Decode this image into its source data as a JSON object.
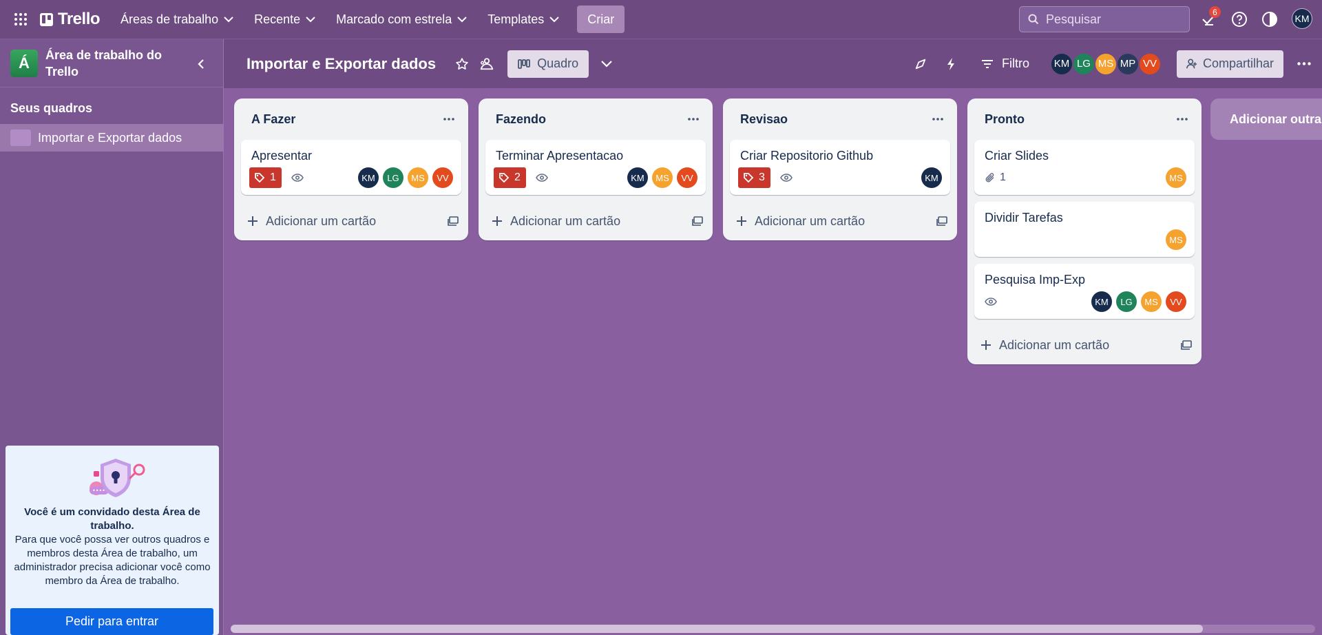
{
  "nav": {
    "logo": "Trello",
    "workspaces": "Áreas de trabalho",
    "recent": "Recente",
    "starred": "Marcado com estrela",
    "templates": "Templates",
    "create": "Criar",
    "search_placeholder": "Pesquisar",
    "notifications_count": "6",
    "user_initials": "KM"
  },
  "sidebar": {
    "workspace_initial": "Á",
    "workspace_name": "Área de trabalho do Trello",
    "boards_title": "Seus quadros",
    "boards": [
      {
        "label": "Importar e Exportar dados"
      }
    ],
    "guest": {
      "title": "Você é um convidado desta Área de trabalho.",
      "body": "Para que você possa ver outros quadros e membros desta Área de trabalho, um administrador precisa adicionar você como membro da Área de trabalho.",
      "button": "Pedir para entrar"
    }
  },
  "board": {
    "title": "Importar e Exportar dados",
    "view": "Quadro",
    "filter": "Filtro",
    "share": "Compartilhar",
    "members": [
      {
        "initials": "KM",
        "color": "#172b4d"
      },
      {
        "initials": "LG",
        "color": "#1f845a"
      },
      {
        "initials": "MS",
        "color": "#f5a22f"
      },
      {
        "initials": "MP",
        "color": "#2b3a5c"
      },
      {
        "initials": "VV",
        "color": "#e34b1f"
      }
    ],
    "add_list": "Adicionar outra lista"
  },
  "lists": [
    {
      "title": "A Fazer",
      "add_card": "Adicionar um cartão",
      "cards": [
        {
          "title": "Apresentar",
          "badge": "1",
          "members": [
            "KM",
            "LG",
            "MS",
            "VV"
          ]
        }
      ]
    },
    {
      "title": "Fazendo",
      "add_card": "Adicionar um cartão",
      "cards": [
        {
          "title": "Terminar Apresentacao",
          "badge": "2",
          "members": [
            "KM",
            "MS",
            "VV"
          ]
        }
      ]
    },
    {
      "title": "Revisao",
      "add_card": "Adicionar um cartão",
      "cards": [
        {
          "title": "Criar Repositorio Github",
          "badge": "3",
          "members": [
            "KM"
          ]
        }
      ]
    },
    {
      "title": "Pronto",
      "add_card": "Adicionar um cartão",
      "cards": [
        {
          "title": "Criar Slides",
          "attachments": "1",
          "members": [
            "MS"
          ]
        },
        {
          "title": "Dividir Tarefas",
          "members": [
            "MS"
          ]
        },
        {
          "title": "Pesquisa Imp-Exp",
          "members": [
            "KM",
            "LG",
            "MS",
            "VV"
          ]
        }
      ]
    }
  ]
}
